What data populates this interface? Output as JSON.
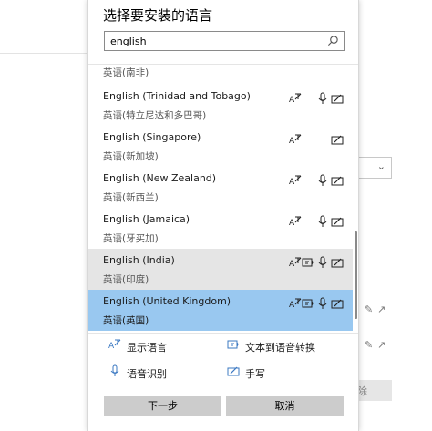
{
  "dialog": {
    "title": "选择要安装的语言",
    "search": {
      "value": "english",
      "placeholder": ""
    }
  },
  "languages": [
    {
      "name": "",
      "native": "英语(南非)",
      "features": []
    },
    {
      "name": "English (Trinidad and Tobago)",
      "native": "英语(特立尼达和多巴哥)",
      "features": [
        "display-language",
        "speech-recognition",
        "handwriting"
      ]
    },
    {
      "name": "English (Singapore)",
      "native": "英语(新加坡)",
      "features": [
        "display-language",
        "handwriting"
      ]
    },
    {
      "name": "English (New Zealand)",
      "native": "英语(新西兰)",
      "features": [
        "display-language",
        "speech-recognition",
        "handwriting"
      ]
    },
    {
      "name": "English (Jamaica)",
      "native": "英语(牙买加)",
      "features": [
        "display-language",
        "speech-recognition",
        "handwriting"
      ]
    },
    {
      "name": "English (India)",
      "native": "英语(印度)",
      "features": [
        "display-language",
        "text-to-speech",
        "speech-recognition",
        "handwriting"
      ]
    },
    {
      "name": "English (United Kingdom)",
      "native": "英语(英国)",
      "features": [
        "display-language",
        "text-to-speech",
        "speech-recognition",
        "handwriting"
      ]
    }
  ],
  "legend": {
    "display_language": "显示语言",
    "text_to_speech": "文本到语音转换",
    "speech_recognition": "语音识别",
    "handwriting": "手写"
  },
  "buttons": {
    "next": "下一步",
    "cancel": "取消"
  },
  "background": {
    "button_partial": "除"
  },
  "colors": {
    "selected": "#99c8f0",
    "hover": "#e5e5e5",
    "button": "#cccccc",
    "icon_blue": "#3b78c2"
  }
}
